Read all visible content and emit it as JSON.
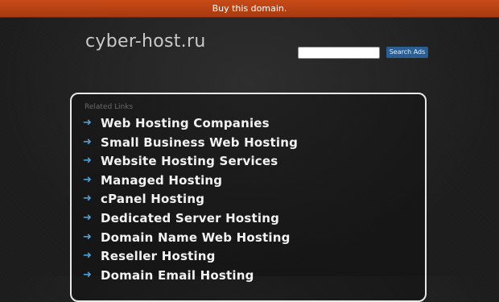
{
  "topbar": {
    "label": "Buy this domain."
  },
  "header": {
    "domain": "cyber-host.ru"
  },
  "search": {
    "placeholder": "",
    "value": "",
    "button_label": "Search Ads"
  },
  "related": {
    "title": "Related Links",
    "items": [
      "Web Hosting Companies",
      "Small Business Web Hosting",
      "Website Hosting Services",
      "Managed Hosting",
      "cPanel Hosting",
      "Dedicated Server Hosting",
      "Domain Name Web Hosting",
      "Reseller Hosting",
      "Domain Email Hosting"
    ],
    "arrow_icon": "arrow-right-icon"
  },
  "colors": {
    "topbar": "#b8431a",
    "search_button": "#2a5f96",
    "arrow": "#4aa0d8",
    "background": "#1c1c1c"
  }
}
